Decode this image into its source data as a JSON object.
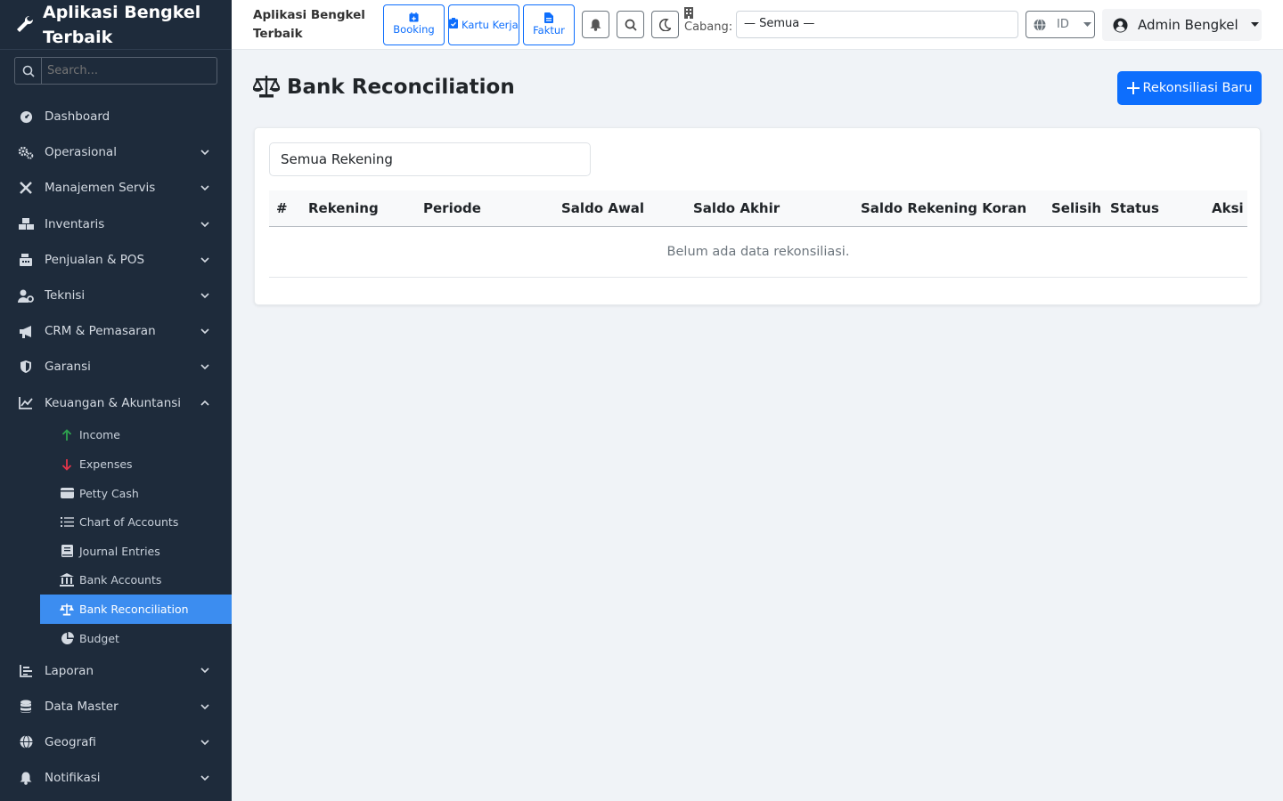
{
  "sidebar": {
    "brand": "Aplikasi Bengkel Terbaik",
    "search_placeholder": "Search...",
    "items": [
      {
        "label": "Dashboard"
      },
      {
        "label": "Operasional"
      },
      {
        "label": "Manajemen Servis"
      },
      {
        "label": "Inventaris"
      },
      {
        "label": "Penjualan & POS"
      },
      {
        "label": "Teknisi"
      },
      {
        "label": "CRM & Pemasaran"
      },
      {
        "label": "Garansi"
      },
      {
        "label": "Keuangan & Akuntansi"
      },
      {
        "label": "Laporan"
      },
      {
        "label": "Data Master"
      },
      {
        "label": "Geografi"
      },
      {
        "label": "Notifikasi"
      }
    ],
    "finance_sub": [
      {
        "label": "Income"
      },
      {
        "label": "Expenses"
      },
      {
        "label": "Petty Cash"
      },
      {
        "label": "Chart of Accounts"
      },
      {
        "label": "Journal Entries"
      },
      {
        "label": "Bank Accounts"
      },
      {
        "label": "Bank Reconciliation"
      },
      {
        "label": "Budget"
      }
    ]
  },
  "topbar": {
    "title": "Aplikasi Bengkel Terbaik",
    "booking": "Booking",
    "kartu_kerja": "Kartu Kerja",
    "faktur": "Faktur",
    "cabang_label": "Cabang:",
    "cabang_value": "— Semua —",
    "lang": "ID",
    "user": "Admin Bengkel"
  },
  "main": {
    "title": "Bank Reconciliation",
    "new_button": "Rekonsiliasi Baru",
    "filter_value": "Semua Rekening",
    "columns": [
      "#",
      "Rekening",
      "Periode",
      "Saldo Awal",
      "Saldo Akhir",
      "Saldo Rekening Koran",
      "Selisih",
      "Status",
      "Aksi"
    ],
    "empty_text": "Belum ada data rekonsiliasi."
  },
  "colors": {
    "sidebar_bg": "#1e2b3b",
    "active": "#3c8df0",
    "primary": "#0d6efd",
    "income_arrow": "#2ea44f",
    "expense_arrow": "#e5354a"
  }
}
